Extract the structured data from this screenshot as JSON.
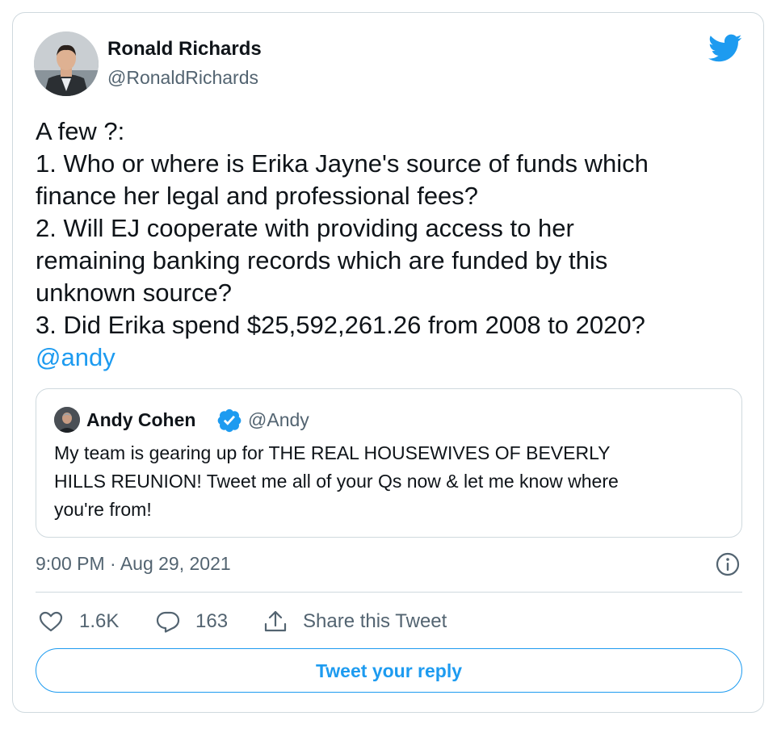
{
  "author": {
    "name": "Ronald Richards",
    "handle": "@RonaldRichards"
  },
  "tweet": {
    "lines": [
      "A few ?:",
      "1. Who or where is Erika Jayne's source of funds which",
      "finance her legal and professional fees?",
      "2. Will EJ cooperate with providing access to her",
      "remaining banking records which are funded by this",
      "unknown source?",
      "3. Did Erika spend $25,592,261.26 from 2008 to 2020?"
    ],
    "mention": "@andy"
  },
  "quoted_tweet": {
    "name": "Andy Cohen",
    "handle": "@Andy",
    "verified": true,
    "lines": [
      "My team is gearing up for THE REAL HOUSEWIVES OF BEVERLY",
      "HILLS REUNION! Tweet me all of your Qs now & let me know where",
      "you're from!"
    ]
  },
  "timestamp": "9:00 PM · Aug 29, 2021",
  "actions": {
    "likes": "1.6K",
    "replies": "163",
    "share": "Share this Tweet"
  },
  "reply_button": "Tweet your reply",
  "icons": [
    "twitter-bird-icon",
    "verified-badge-icon",
    "info-icon",
    "heart-icon",
    "reply-bubble-icon",
    "share-icon"
  ],
  "colors": {
    "accent": "#1d9bf0",
    "text": "#0f1419",
    "secondary": "#536471",
    "border": "#cfd9de"
  }
}
